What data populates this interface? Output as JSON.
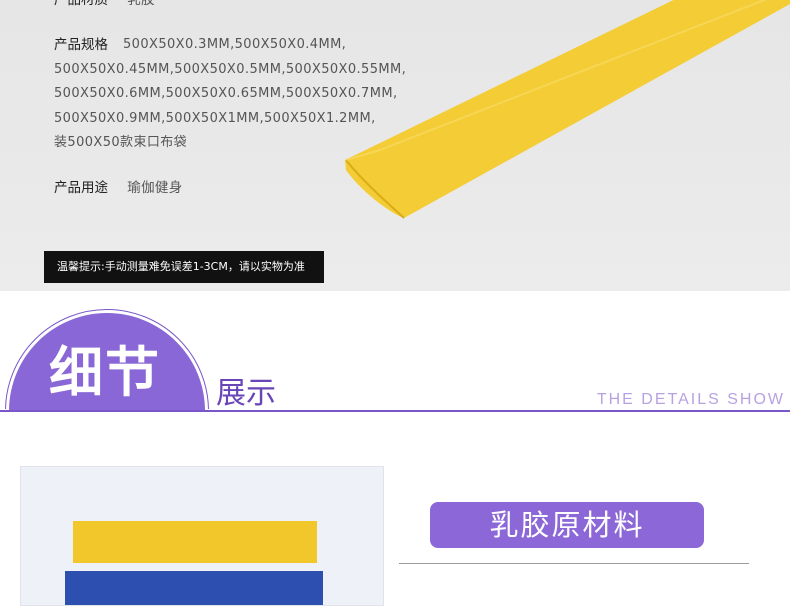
{
  "specs": {
    "material_label": "产品材质",
    "material_value": "乳胶",
    "size_label": "产品规格",
    "size_lines": [
      "500X50X0.3MM,500X50X0.4MM,",
      "500X50X0.45MM,500X50X0.5MM,500X50X0.55MM,",
      "500X50X0.6MM,500X50X0.65MM,500X50X0.7MM,",
      "500X50X0.9MM,500X50X1MM,500X50X1.2MM,",
      "装500X50款束口布袋"
    ],
    "usage_label": "产品用途",
    "usage_value": "瑜伽健身"
  },
  "tip": "温馨提示:手动测量难免误差1-3CM，请以实物为准",
  "section": {
    "title": "细节",
    "subtitle": "展示",
    "english": "THE DETAILS SHOW"
  },
  "detail": {
    "tag": "乳胶原材料"
  },
  "colors": {
    "purple": "#8a67d6",
    "band_yellow": "#f4cc35",
    "band_blue": "#2d4fb0"
  }
}
